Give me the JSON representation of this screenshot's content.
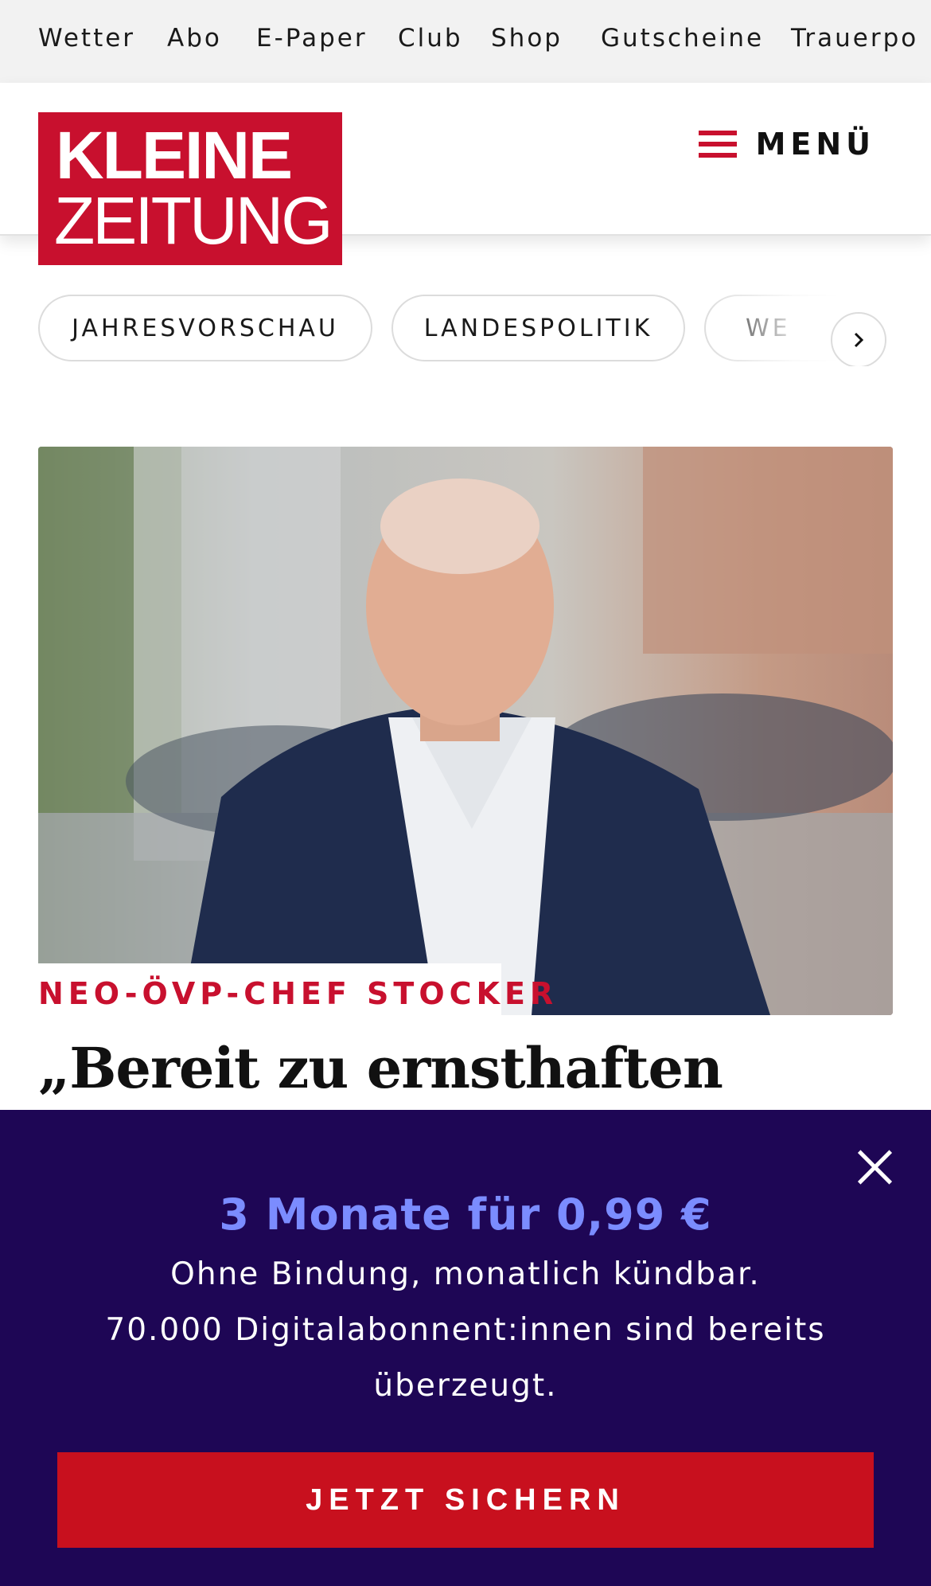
{
  "topnav": {
    "links": [
      "Wetter",
      "Abo",
      "E-Paper",
      "Club",
      "Shop",
      "Gutscheine",
      "Trauerpo"
    ]
  },
  "header": {
    "logo_line1": "KLEINE",
    "logo_line2": "ZEITUNG",
    "menu_label": "MENÜ"
  },
  "chips": {
    "items": [
      "JAHRESVORSCHAU",
      "LANDESPOLITIK",
      "WE"
    ]
  },
  "article": {
    "kicker": "NEO-ÖVP-CHEF STOCKER",
    "headline": "„Bereit zu ernsthaften"
  },
  "promo": {
    "offer": "3 Monate für 0,99 €",
    "line1": "Ohne Bindung, monatlich kündbar.",
    "line2": "70.000 Digitalabonnent:innen sind bereits",
    "line3": "überzeugt.",
    "cta": "JETZT SICHERN"
  },
  "colors": {
    "brand_red": "#c8102e",
    "promo_bg": "#1e0655",
    "promo_accent": "#7b8cff"
  }
}
